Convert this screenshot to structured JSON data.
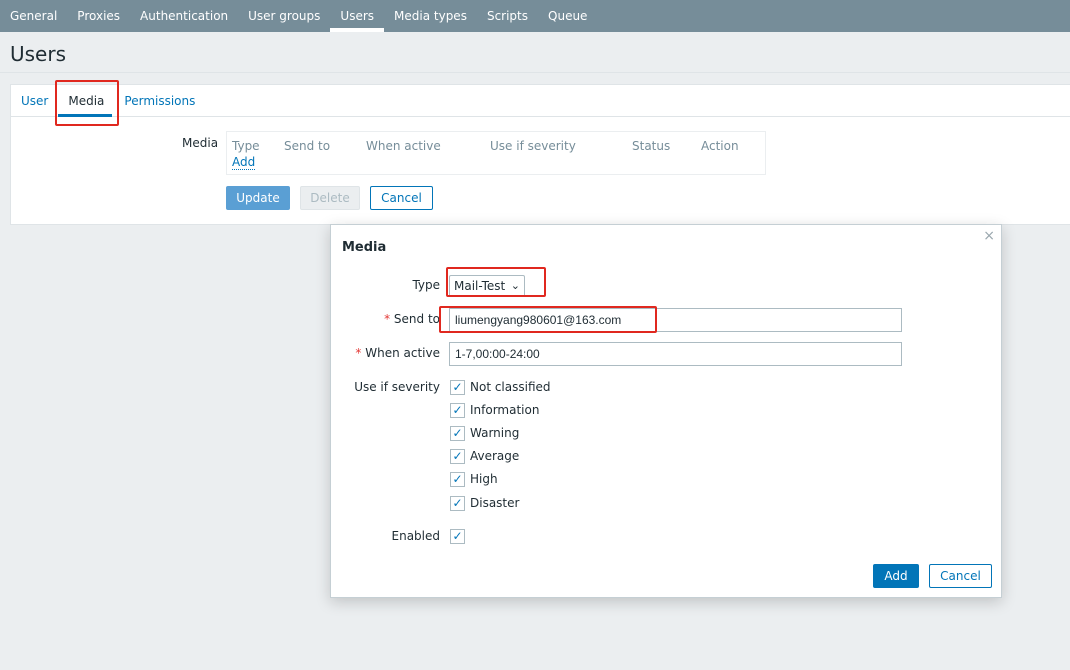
{
  "nav": {
    "items": [
      "General",
      "Proxies",
      "Authentication",
      "User groups",
      "Users",
      "Media types",
      "Scripts",
      "Queue"
    ],
    "active": "Users"
  },
  "page": {
    "title": "Users"
  },
  "tabs": [
    "User",
    "Media",
    "Permissions"
  ],
  "form": {
    "media_label": "Media",
    "table_headers": [
      "Type",
      "Send to",
      "When active",
      "Use if severity",
      "Status",
      "Action"
    ],
    "add_link": "Add",
    "buttons": {
      "update": "Update",
      "delete": "Delete",
      "cancel": "Cancel"
    }
  },
  "modal": {
    "title": "Media",
    "close": "×",
    "type_label": "Type",
    "type_value": "Mail-Test",
    "send_to_label": "Send to",
    "send_to_value": "liumengyang980601@163.com",
    "when_active_label": "When active",
    "when_active_value": "1-7,00:00-24:00",
    "severity_label": "Use if severity",
    "severities": [
      {
        "label": "Not classified",
        "checked": true
      },
      {
        "label": "Information",
        "checked": true
      },
      {
        "label": "Warning",
        "checked": true
      },
      {
        "label": "Average",
        "checked": true
      },
      {
        "label": "High",
        "checked": true
      },
      {
        "label": "Disaster",
        "checked": true
      }
    ],
    "enabled_label": "Enabled",
    "enabled": true,
    "required_mark": "*",
    "buttons": {
      "add": "Add",
      "cancel": "Cancel"
    }
  },
  "colors": {
    "nav_bg": "#768d99",
    "accent": "#0275b8",
    "highlight": "#e0281f"
  }
}
